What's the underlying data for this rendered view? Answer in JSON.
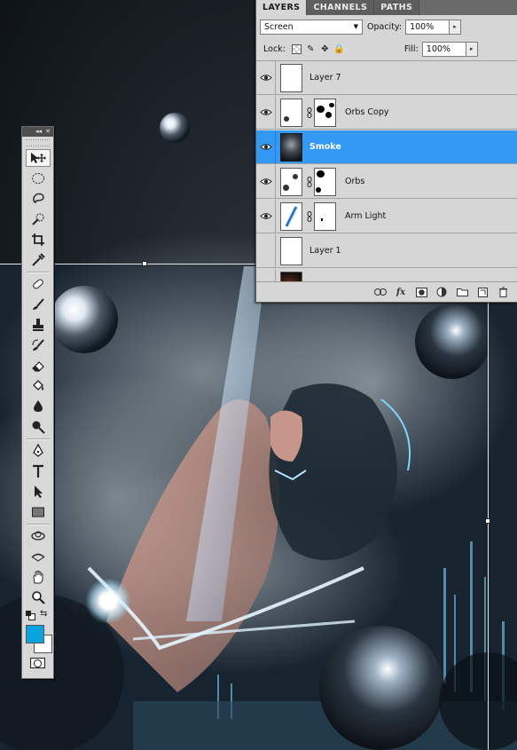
{
  "layers_panel": {
    "tabs": [
      {
        "label": "LAYERS"
      },
      {
        "label": "CHANNELS"
      },
      {
        "label": "PATHS"
      }
    ],
    "blend_mode": "Screen",
    "opacity_label": "Opacity:",
    "opacity_value": "100%",
    "lock_label": "Lock:",
    "fill_label": "Fill:",
    "fill_value": "100%",
    "layers": [
      {
        "name": "Layer 7",
        "visible": true,
        "mask": false,
        "selected": false
      },
      {
        "name": "Orbs Copy",
        "visible": true,
        "mask": true,
        "selected": false
      },
      {
        "name": "Smoke",
        "visible": true,
        "mask": false,
        "selected": true
      },
      {
        "name": "Orbs",
        "visible": true,
        "mask": true,
        "selected": false
      },
      {
        "name": "Arm Light",
        "visible": true,
        "mask": true,
        "selected": false
      },
      {
        "name": "Layer 1",
        "visible": false,
        "mask": false,
        "selected": false
      }
    ],
    "bottom_icons": [
      "link-icon",
      "fx-icon",
      "add-mask-icon",
      "adjustment-icon",
      "group-folder-icon",
      "new-layer-icon",
      "trash-icon"
    ]
  },
  "tools_panel": {
    "tools": [
      "move-tool",
      "marquee-tool",
      "lasso-tool",
      "quick-selection-tool",
      "crop-tool",
      "eyedropper-tool",
      "healing-brush-tool",
      "brush-tool",
      "clone-stamp-tool",
      "history-brush-tool",
      "eraser-tool",
      "paint-bucket-tool",
      "blur-tool",
      "dodge-tool",
      "pen-tool",
      "type-tool",
      "path-selection-tool",
      "rectangle-tool",
      "3d-rotate-tool",
      "3d-orbit-tool",
      "hand-tool",
      "zoom-tool"
    ],
    "foreground_color": "#0aa3e0",
    "background_color": "#ffffff"
  },
  "colors": {
    "selection_blue": "#3498f5",
    "panel_gray": "#d6d6d6"
  }
}
